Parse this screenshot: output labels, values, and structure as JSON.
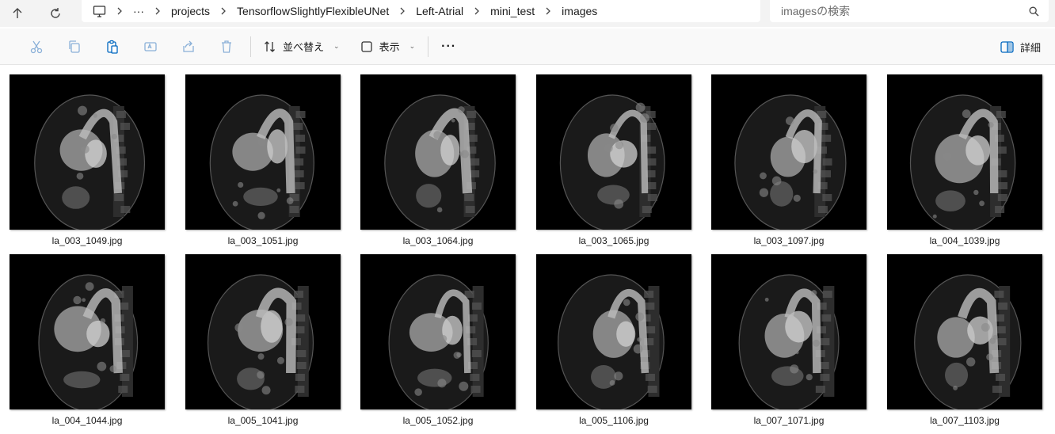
{
  "address_bar": {
    "breadcrumb": [
      "projects",
      "TensorflowSlightlyFlexibleUNet",
      "Left-Atrial",
      "mini_test",
      "images"
    ],
    "overflow": "···",
    "search_placeholder": "imagesの検索"
  },
  "command_bar": {
    "sort_label": "並べ替え",
    "view_label": "表示",
    "more_label": "···",
    "details_label": "詳細"
  },
  "icons": {
    "up": "arrow-up-icon",
    "refresh": "refresh-icon",
    "pc": "this-pc-icon",
    "search": "search-icon",
    "cut": "cut-icon",
    "copy": "copy-icon",
    "paste": "paste-icon",
    "rename": "rename-icon",
    "share": "share-icon",
    "delete": "delete-icon",
    "sort": "sort-icon",
    "view": "view-icon",
    "details": "details-pane-icon"
  },
  "colors": {
    "accent": "#0067c0",
    "disabled_icon": "#8ab0d8",
    "thumb_bg": "#000000"
  },
  "files": [
    {
      "name": "la_003_1049.jpg"
    },
    {
      "name": "la_003_1051.jpg"
    },
    {
      "name": "la_003_1064.jpg"
    },
    {
      "name": "la_003_1065.jpg"
    },
    {
      "name": "la_003_1097.jpg"
    },
    {
      "name": "la_004_1039.jpg"
    },
    {
      "name": "la_004_1044.jpg"
    },
    {
      "name": "la_005_1041.jpg"
    },
    {
      "name": "la_005_1052.jpg"
    },
    {
      "name": "la_005_1106.jpg"
    },
    {
      "name": "la_007_1071.jpg"
    },
    {
      "name": "la_007_1103.jpg"
    }
  ]
}
